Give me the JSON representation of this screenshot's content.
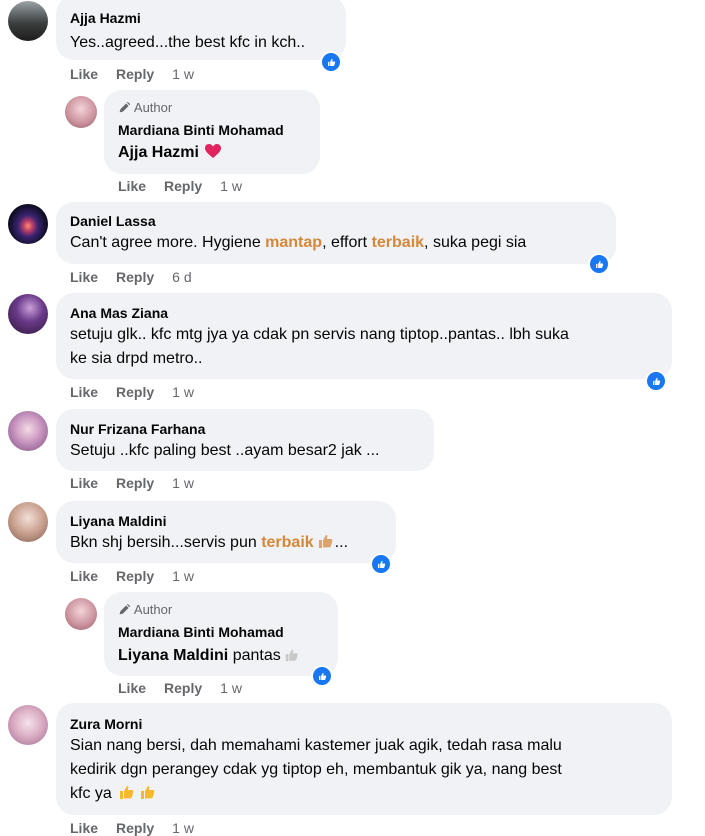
{
  "comments": [
    {
      "name": "Ajja Hazmi",
      "text": "Yes..agreed...the best kfc in kch..",
      "like": "Like",
      "reply": "Reply",
      "time": "1 w"
    },
    {
      "badge": "Author",
      "name": "Mardiana Binti Mohamad",
      "mention": "Ajja Hazmi",
      "like": "Like",
      "reply": "Reply",
      "time": "1 w"
    },
    {
      "name": "Daniel Lassa",
      "text_a": "Can't agree more. Hygiene ",
      "hl1": "mantap",
      "text_b": ", effort ",
      "hl2": "terbaik",
      "text_c": ", suka pegi sia",
      "like": "Like",
      "reply": "Reply",
      "time": "6 d"
    },
    {
      "name": "Ana Mas Ziana",
      "line1": "setuju glk.. kfc mtg jya ya cdak pn servis nang tiptop..pantas.. lbh suka",
      "line2": "ke sia drpd metro..",
      "like": "Like",
      "reply": "Reply",
      "time": "1 w"
    },
    {
      "name": "Nur Frizana Farhana",
      "text": "Setuju ..kfc paling best ..ayam besar2 jak ...",
      "like": "Like",
      "reply": "Reply",
      "time": "1 w"
    },
    {
      "name": "Liyana Maldini",
      "text_a": "Bkn shj bersih...servis pun ",
      "hl": "terbaik",
      "text_b": "...",
      "like": "Like",
      "reply": "Reply",
      "time": "1 w"
    },
    {
      "badge": "Author",
      "name": "Mardiana Binti Mohamad",
      "mention": "Liyana Maldini",
      "text": " pantas",
      "like": "Like",
      "reply": "Reply",
      "time": "1 w"
    },
    {
      "name": "Zura Morni",
      "line1": "Sian nang bersi, dah memahami kastemer juak agik, tedah rasa malu",
      "line2": "kedirik dgn perangey cdak yg tiptop eh, membantuk gik ya, nang best",
      "line3": "kfc ya",
      "like": "Like",
      "reply": "Reply",
      "time": "1 w"
    }
  ],
  "colors": {
    "bubble": "#f0f2f5",
    "highlight": "#d4883a",
    "like_blue": "#1877f2",
    "meta": "#65676b"
  }
}
